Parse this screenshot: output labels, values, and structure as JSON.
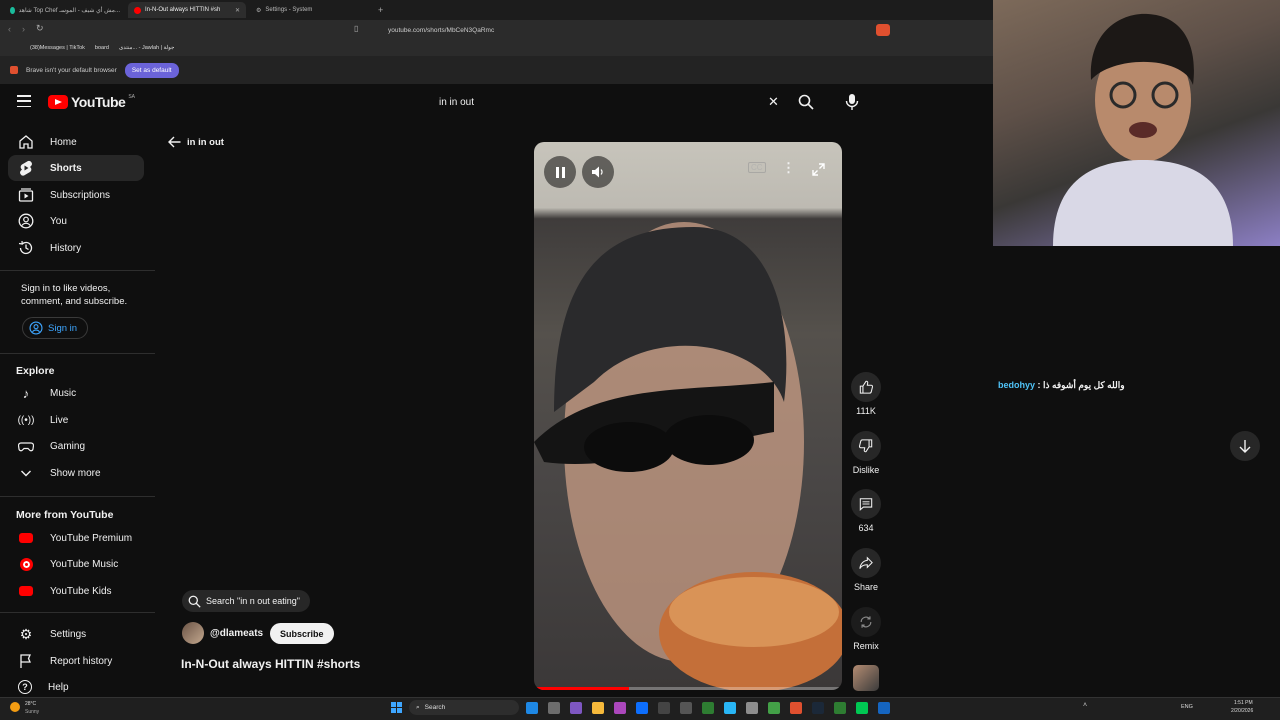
{
  "browser": {
    "tabs": [
      {
        "label": "شاهد Top Chef مش أي شيف - الموسـ...",
        "color": "#1abc9c"
      },
      {
        "label": "In-N-Out always HITTIN #sh",
        "color": "#ff0000"
      },
      {
        "label": "Settings - System",
        "color": "#888888"
      }
    ],
    "url": "youtube.com/shorts/MbCeN3QaRmc",
    "bookmarks": [
      "(38)Messages | TikTok",
      "board",
      "منتدى... - Jawlah | جولة"
    ],
    "infobar_text": "Brave isn't your default browser",
    "set_default": "Set as default"
  },
  "youtube": {
    "logo_text": "YouTube",
    "logo_country": "SA",
    "search_value": "in in out",
    "sidebar": {
      "main": [
        {
          "label": "Home",
          "icon": "home-icon"
        },
        {
          "label": "Shorts",
          "icon": "shorts-icon",
          "active": true
        },
        {
          "label": "Subscriptions",
          "icon": "subscriptions-icon"
        },
        {
          "label": "You",
          "icon": "person-icon"
        },
        {
          "label": "History",
          "icon": "history-icon"
        }
      ],
      "signin_prompt": "Sign in to like videos, comment, and subscribe.",
      "signin_label": "Sign in",
      "explore_title": "Explore",
      "explore": [
        {
          "label": "Music",
          "icon": "music-icon"
        },
        {
          "label": "Live",
          "icon": "live-icon"
        },
        {
          "label": "Gaming",
          "icon": "gaming-icon"
        },
        {
          "label": "Show more",
          "icon": "chevron-down-icon"
        }
      ],
      "more_title": "More from YouTube",
      "more": [
        {
          "label": "YouTube Premium"
        },
        {
          "label": "YouTube Music"
        },
        {
          "label": "YouTube Kids"
        }
      ],
      "footer": [
        {
          "label": "Settings",
          "icon": "gear-icon"
        },
        {
          "label": "Report history",
          "icon": "flag-icon"
        },
        {
          "label": "Help",
          "icon": "help-icon"
        }
      ]
    },
    "back_label": "in in out",
    "short": {
      "search_chip": "Search \"in n out eating\"",
      "channel": "@dlameats",
      "subscribe": "Subscribe",
      "title": "In-N-Out always HITTIN #shorts",
      "progress": 0.31
    },
    "actions": [
      {
        "label": "111K",
        "icon": "like-icon"
      },
      {
        "label": "Dislike",
        "icon": "dislike-icon"
      },
      {
        "label": "634",
        "icon": "comment-icon"
      },
      {
        "label": "Share",
        "icon": "share-icon"
      },
      {
        "label": "Remix",
        "icon": "remix-icon"
      }
    ]
  },
  "stream": {
    "chat_user": "bedohyy",
    "chat_message": "والله كل يوم أشوفه ذا"
  },
  "taskbar": {
    "weather_temp": "28°C",
    "weather_desc": "Sunny",
    "search_label": "Search",
    "lang": "ENG",
    "time": "1:51 PM",
    "date": "2/20/2026"
  }
}
